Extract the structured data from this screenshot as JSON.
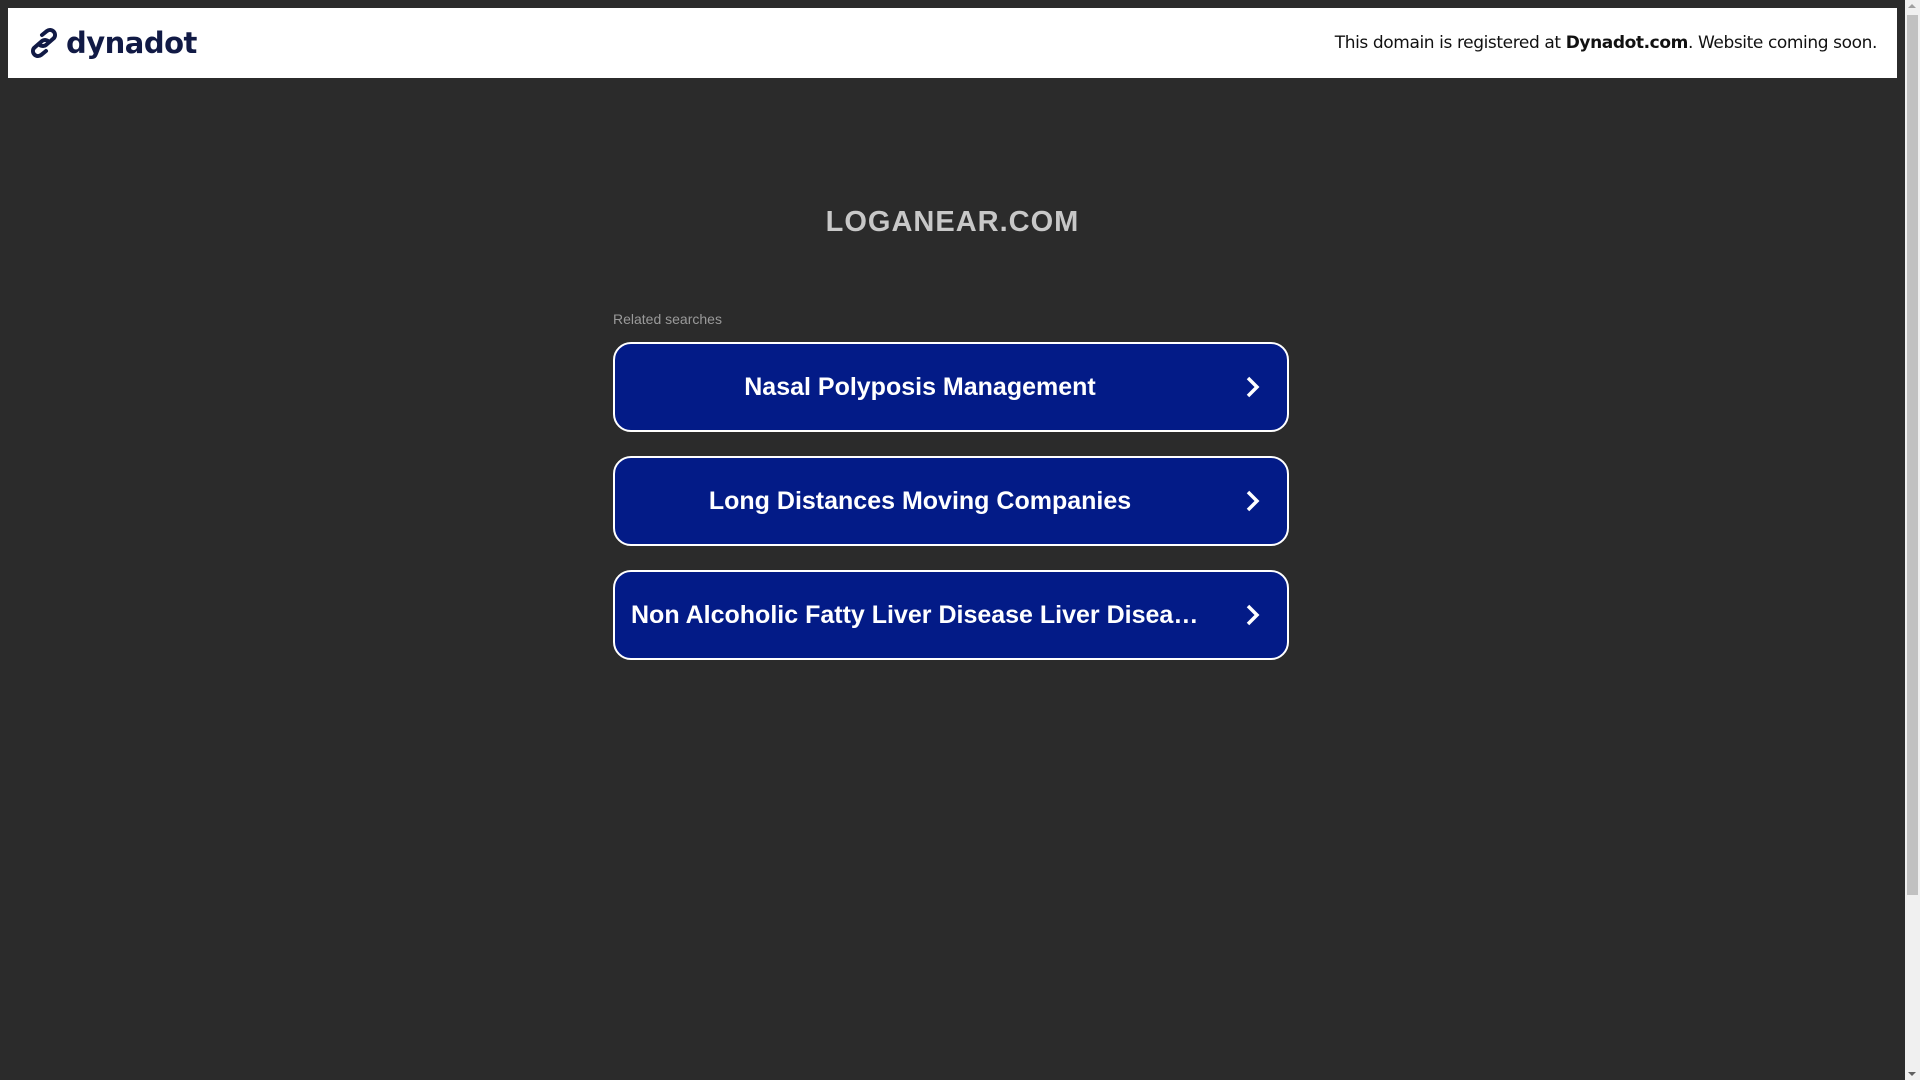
{
  "header": {
    "logo_text": "dynadot",
    "notice_prefix": "This domain is registered at ",
    "notice_brand": "Dynadot.com",
    "notice_suffix": ". Website coming soon."
  },
  "main": {
    "domain_title": "LOGANEAR.COM",
    "related_label": "Related searches",
    "links": [
      {
        "label": "Nasal Polyposis Management"
      },
      {
        "label": "Long Distances Moving Companies"
      },
      {
        "label": "Non Alcoholic Fatty Liver Disease Liver Disease Treatment"
      }
    ]
  },
  "colors": {
    "button_bg": "#031b87",
    "page_bg": "#2b2b2b",
    "logo": "#111a45"
  }
}
